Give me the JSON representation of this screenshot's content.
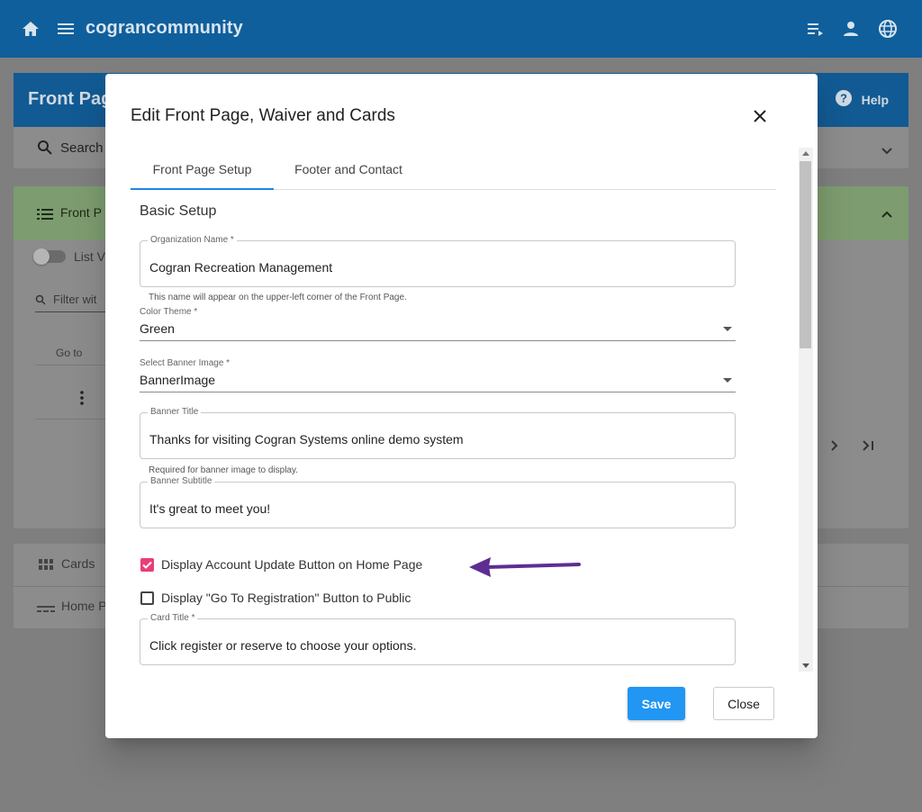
{
  "appbar": {
    "brand": "cograncommunity",
    "color": "#0f5f9c"
  },
  "background_page": {
    "header_title": "Front Pag",
    "help_label": "Help",
    "search_label": "Search",
    "section_label": "Front P",
    "toggle_label": "List V",
    "filter_placeholder": "Filter wit",
    "goto_label": "Go to",
    "cards_label": "Cards",
    "home_label": "Home P"
  },
  "modal": {
    "title": "Edit Front Page, Waiver and Cards",
    "tabs": [
      {
        "label": "Front Page Setup",
        "active": true
      },
      {
        "label": "Footer and Contact",
        "active": false
      }
    ],
    "section_heading": "Basic Setup",
    "org_name": {
      "label": "Organization Name *",
      "value": "Cogran Recreation Management",
      "hint": "This name will appear on the upper-left corner of the Front Page."
    },
    "color_theme": {
      "label": "Color Theme *",
      "value": "Green"
    },
    "banner_image": {
      "label": "Select Banner Image *",
      "value": "BannerImage"
    },
    "banner_title": {
      "label": "Banner Title",
      "value": "Thanks for visiting Cogran Systems online demo system",
      "hint": "Required for banner image to display."
    },
    "banner_subtitle": {
      "label": "Banner Subtitle",
      "value": "It's great to meet you!"
    },
    "checkboxes": [
      {
        "label": "Display Account Update Button on Home Page",
        "checked": true
      },
      {
        "label": "Display \"Go To Registration\" Button to Public",
        "checked": false
      }
    ],
    "card_title": {
      "label": "Card Title *",
      "value": "Click register or reserve to choose your options."
    },
    "save_label": "Save",
    "close_label": "Close",
    "accent_color": "#2196f3",
    "checkbox_color": "#e83e7a",
    "arrow_color": "#5e2d91"
  }
}
